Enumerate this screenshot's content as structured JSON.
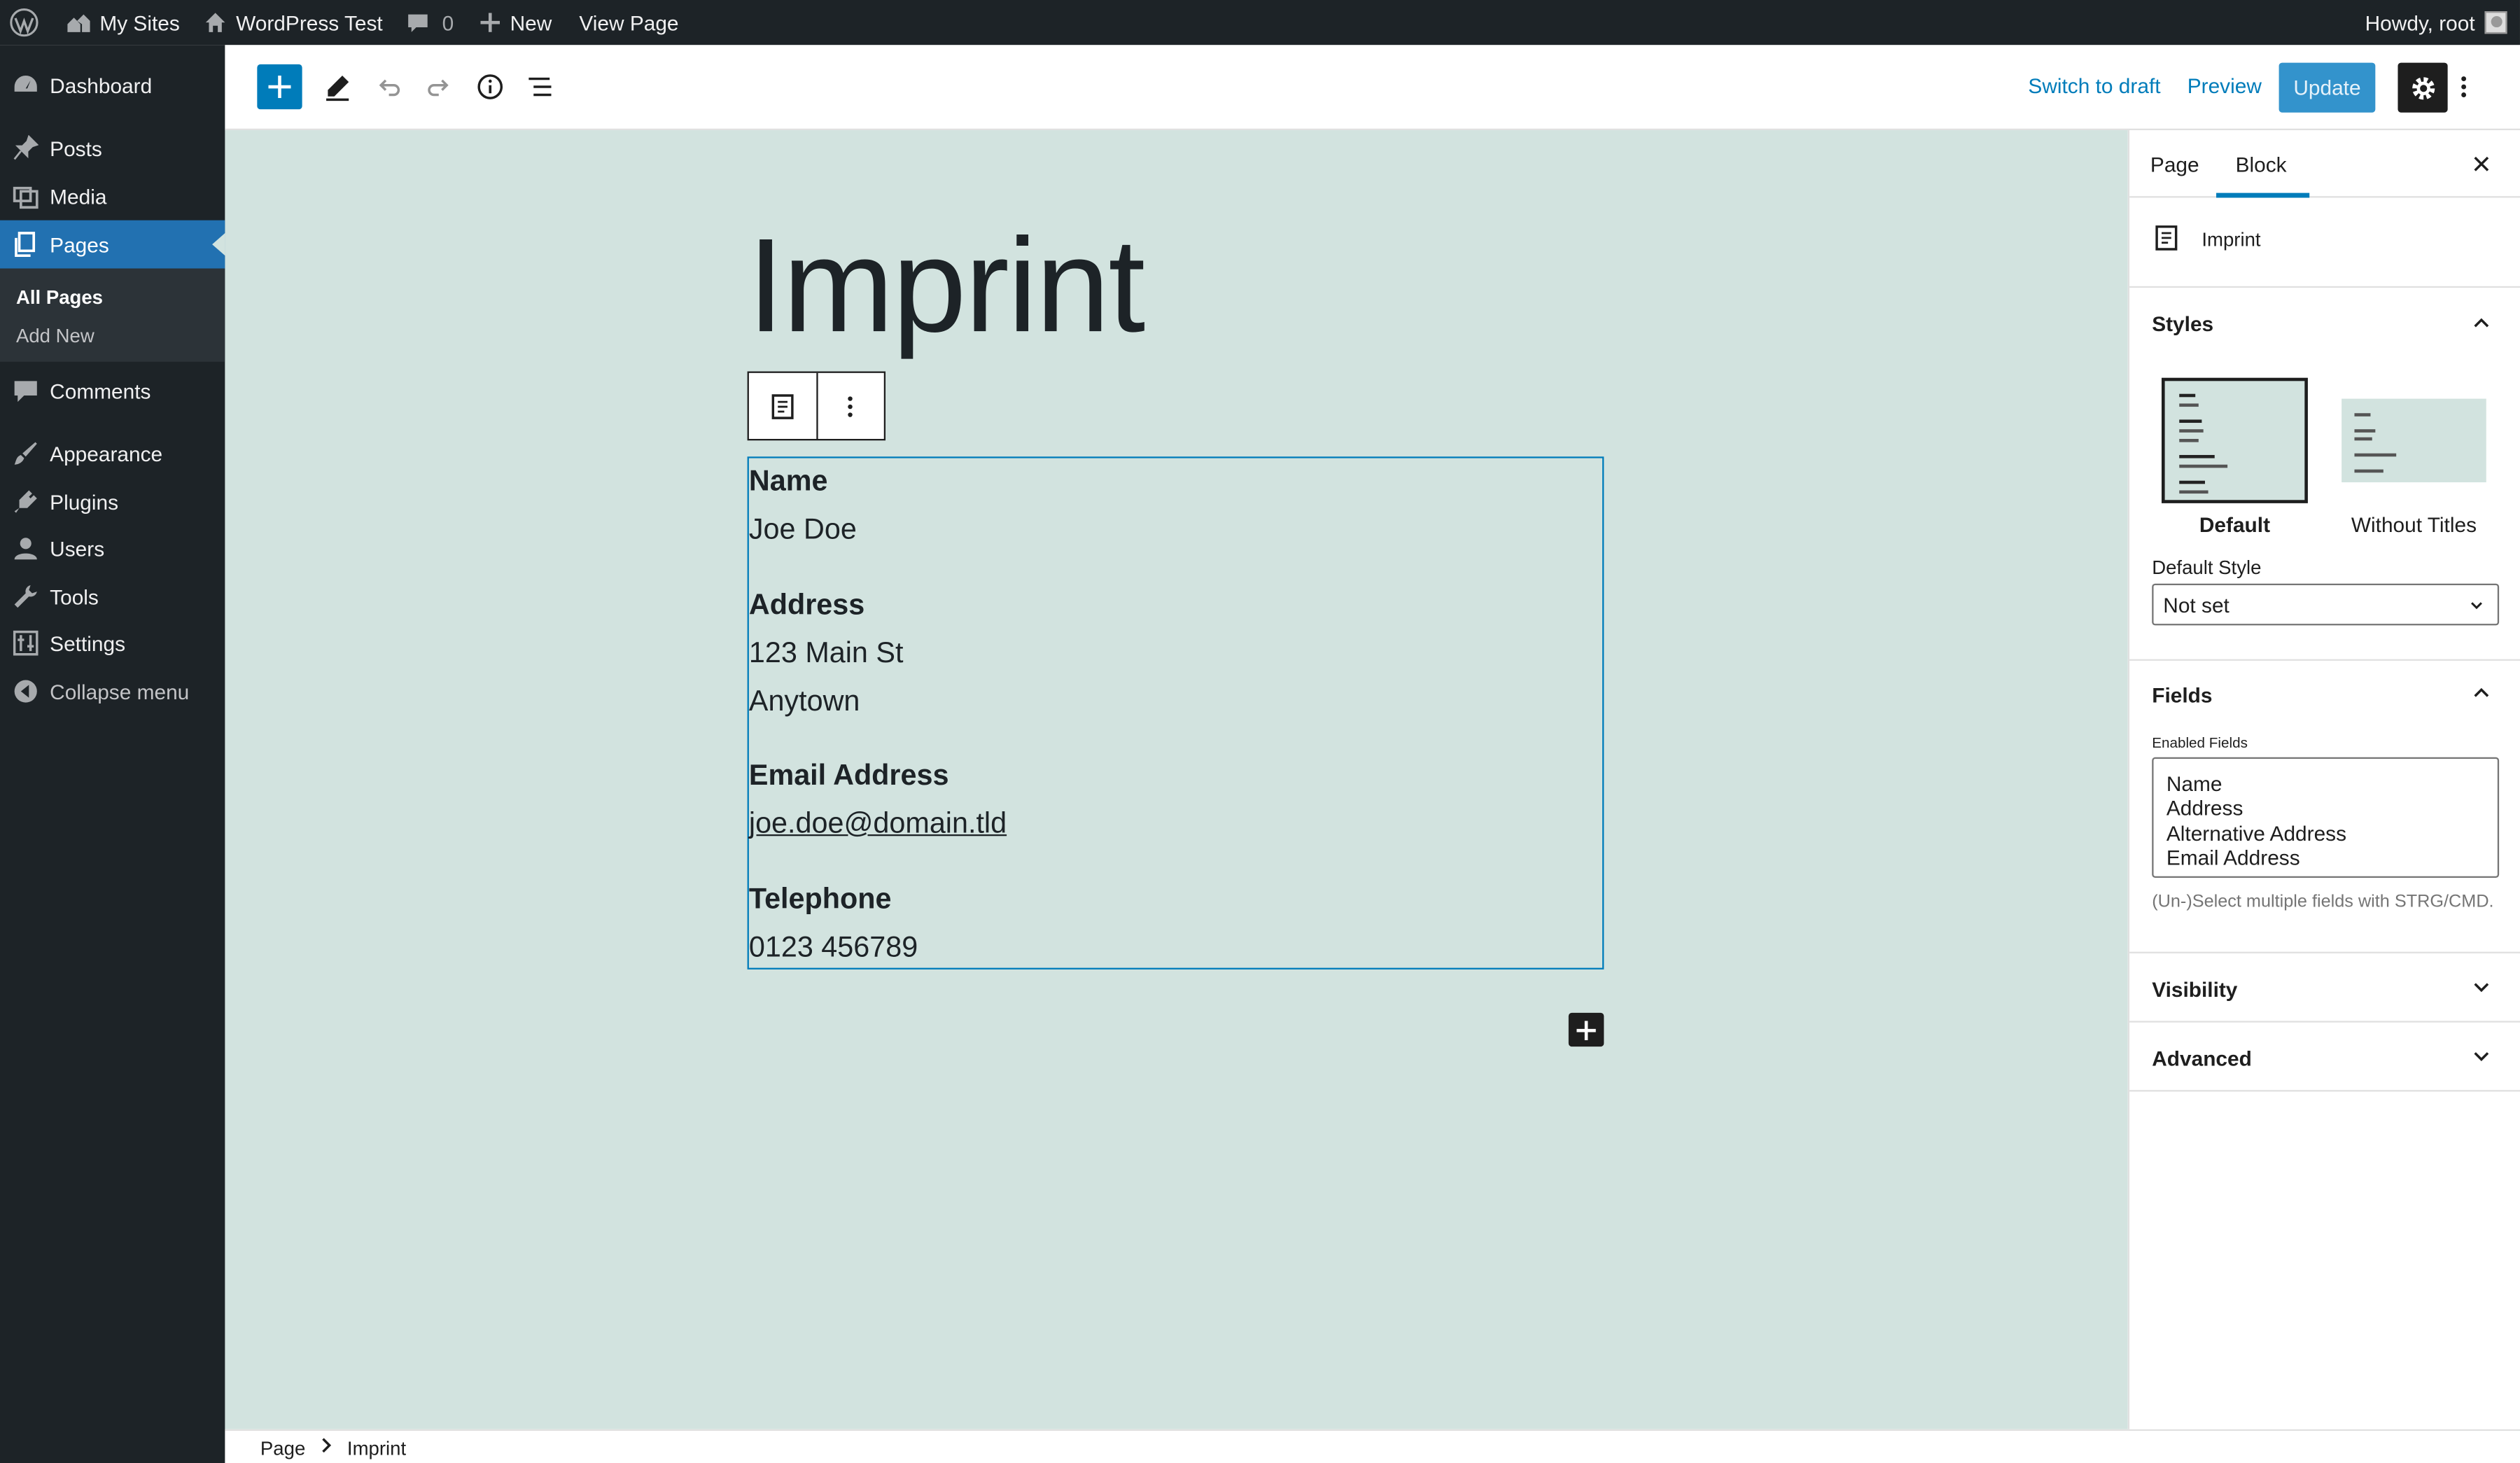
{
  "admin_bar": {
    "my_sites": "My Sites",
    "site_name": "WordPress Test",
    "comments_count": "0",
    "new_label": "New",
    "view_page": "View Page",
    "howdy": "Howdy, root"
  },
  "admin_menu": {
    "items": [
      {
        "label": "Dashboard",
        "icon": "dashboard-icon"
      },
      {
        "label": "Posts",
        "icon": "pin-icon"
      },
      {
        "label": "Media",
        "icon": "media-icon"
      },
      {
        "label": "Pages",
        "icon": "pages-icon",
        "active": true
      },
      {
        "label": "Comments",
        "icon": "comment-icon"
      },
      {
        "label": "Appearance",
        "icon": "brush-icon"
      },
      {
        "label": "Plugins",
        "icon": "plugin-icon"
      },
      {
        "label": "Users",
        "icon": "user-icon"
      },
      {
        "label": "Tools",
        "icon": "wrench-icon"
      },
      {
        "label": "Settings",
        "icon": "settings-icon"
      }
    ],
    "submenu": {
      "all_pages": "All Pages",
      "add_new": "Add New"
    },
    "collapse": "Collapse menu"
  },
  "editor_header": {
    "switch_to_draft": "Switch to draft",
    "preview": "Preview",
    "update": "Update"
  },
  "content": {
    "title": "Imprint",
    "fields": [
      {
        "label": "Name",
        "lines": [
          "Joe Doe"
        ]
      },
      {
        "label": "Address",
        "lines": [
          "123 Main St",
          "Anytown"
        ]
      },
      {
        "label": "Email Address",
        "lines": [
          "joe.doe@domain.tld"
        ]
      },
      {
        "label": "Telephone",
        "lines": [
          "0123 456789"
        ]
      }
    ]
  },
  "breadcrumb": {
    "root": "Page",
    "current": "Imprint"
  },
  "sidebar": {
    "tabs": {
      "page": "Page",
      "block": "Block"
    },
    "block_name": "Imprint",
    "styles": {
      "heading": "Styles",
      "default": "Default",
      "without_titles": "Without Titles",
      "default_style_label": "Default Style",
      "default_style_value": "Not set"
    },
    "fields": {
      "heading": "Fields",
      "enabled_label": "Enabled Fields",
      "options": [
        "Name",
        "Address",
        "Alternative Address",
        "Email Address"
      ],
      "help": "(Un-)Select multiple fields with STRG/CMD."
    },
    "visibility": "Visibility",
    "advanced": "Advanced"
  },
  "colors": {
    "accent": "#007cba",
    "admin_dark": "#1d2327",
    "menu_active": "#2271b1",
    "canvas_bg": "#d2e3df"
  }
}
